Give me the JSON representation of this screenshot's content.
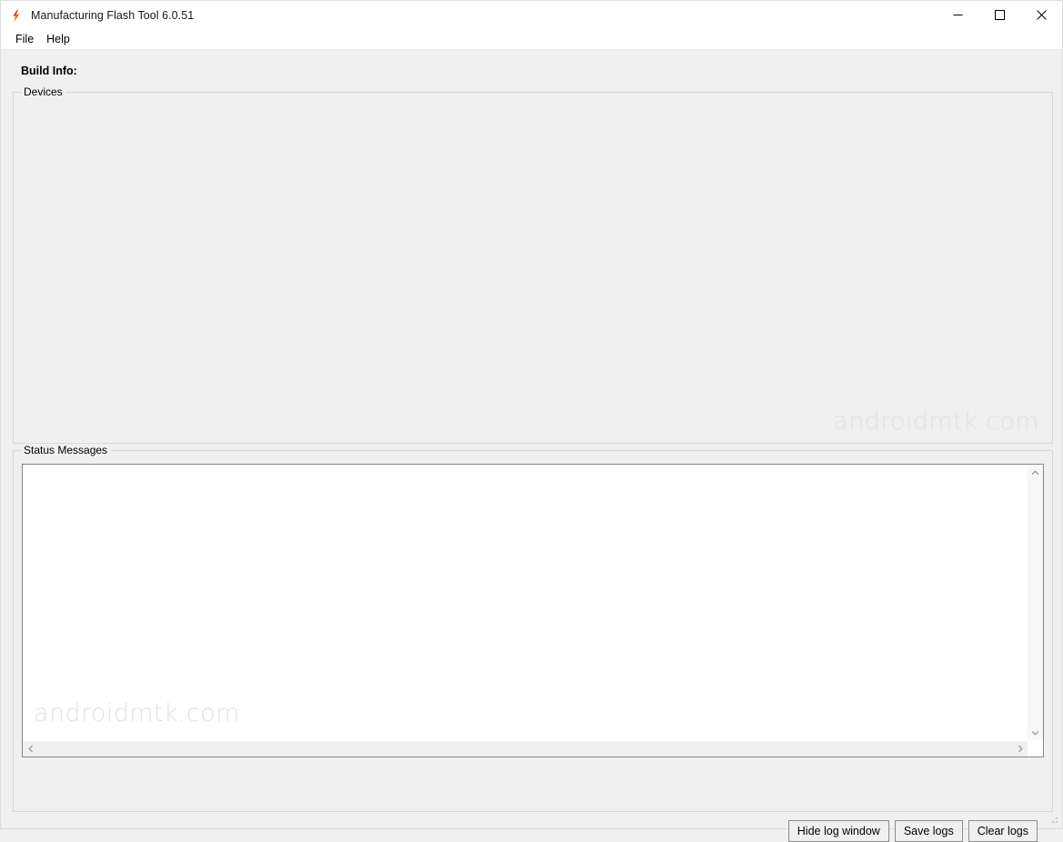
{
  "window": {
    "title": "Manufacturing Flash Tool 6.0.51",
    "icon": "lightning-bolt-icon",
    "accent_color": "#e8700f",
    "background_color": "#f0f0f0",
    "titlebar_color": "#ffffff",
    "caption_buttons": [
      {
        "name": "minimize",
        "glyph": "—"
      },
      {
        "name": "maximize",
        "glyph": "□"
      },
      {
        "name": "close",
        "glyph": "✕"
      }
    ]
  },
  "menubar": {
    "items": [
      {
        "label": "File"
      },
      {
        "label": "Help"
      }
    ]
  },
  "main": {
    "build_info_label": "Build Info:",
    "build_info_value": "",
    "devices": {
      "group_label": "Devices",
      "rows": [],
      "watermark": "androidmtk.com"
    },
    "status": {
      "group_label": "Status Messages",
      "log_text": "",
      "watermark": "androidmtk.com",
      "scrollbars": {
        "vertical": {
          "up_arrow": "chevron-up",
          "down_arrow": "chevron-down"
        },
        "horizontal": {
          "left_arrow": "chevron-left",
          "right_arrow": "chevron-right"
        }
      }
    },
    "buttons": [
      {
        "label": "Hide log window",
        "name": "hide-log-window-button"
      },
      {
        "label": "Save logs",
        "name": "save-logs-button"
      },
      {
        "label": "Clear logs",
        "name": "clear-logs-button"
      }
    ]
  }
}
